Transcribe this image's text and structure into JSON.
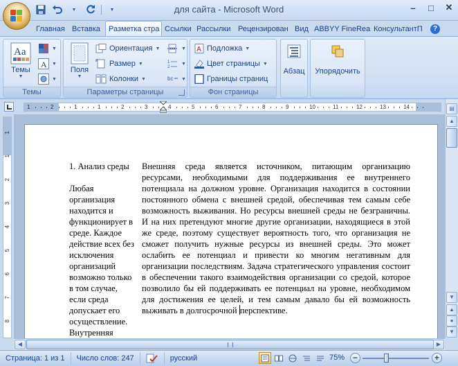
{
  "app": {
    "title": "для сайта - Microsoft Word"
  },
  "window_controls": {
    "minimize": "–",
    "maximize": "□",
    "close": "✕"
  },
  "tabs": [
    {
      "label": "Главная",
      "active": false
    },
    {
      "label": "Вставка",
      "active": false
    },
    {
      "label": "Разметка стра",
      "active": true
    },
    {
      "label": "Ссылки",
      "active": false
    },
    {
      "label": "Рассылки",
      "active": false
    },
    {
      "label": "Рецензирован",
      "active": false
    },
    {
      "label": "Вид",
      "active": false
    },
    {
      "label": "ABBYY FineRea",
      "active": false
    },
    {
      "label": "КонсультантП",
      "active": false
    }
  ],
  "ribbon": {
    "themes_group": {
      "label": "Темы",
      "themes_button": "Темы"
    },
    "page_setup_group": {
      "label": "Параметры страницы",
      "margins_button": "Поля",
      "orientation": "Ориентация",
      "size": "Размер",
      "columns": "Колонки"
    },
    "page_bg_group": {
      "label": "Фон страницы",
      "watermark": "Подложка",
      "page_color": "Цвет страницы",
      "page_borders": "Границы страниц"
    },
    "paragraph_button": "Абзац",
    "arrange_button": "Упорядочить"
  },
  "ruler": {
    "numbers": [
      "1",
      "2",
      "1",
      "1",
      "2",
      "3",
      "4",
      "5",
      "6",
      "7",
      "8",
      "9",
      "10",
      "11",
      "12",
      "13",
      "14"
    ]
  },
  "vruler_numbers": [
    "1",
    "1",
    "2",
    "3",
    "4",
    "5",
    "6",
    "7",
    "8"
  ],
  "document": {
    "left_column": "1. Анализ среды\n\nЛюбая\nорганизация\nнаходится и\nфункционирует в\nсреде. Каждое\nдействие всех без\nисключения\nорганизаций\nвозможно только\nв том случае,\nесли среда\nдопускает его\nосуществление.\nВнутренняя",
    "right_column": "Внешняя  среда является источником, питающим организацию ресурсами, необходимыми для поддерживания ее внутреннего потенциала на должном уровне. Организация находится в состоянии постоянного обмена с внешней средой, обеспечивая тем самым себе возможность выживания. Но ресурсы внешней среды не безграничны. И на них претендуют многие другие организации, находящиеся в этой же среде, поэтому существует вероятность того, что организация не сможет получить нужные ресурсы из внешней среды. Это может ослабить ее потенциал и привести ко многим негативным для организации последствиям. Задача стратегического управления состоит в обеспечении такого взаимодействия организации со средой, которое позволило бы ей поддерживать ее потенциал на уровне, необходимом для достижения ее целей, и тем самым давало бы ей возможность выживать в долгосрочной",
    "right_column_tail": "перспективе."
  },
  "statusbar": {
    "page": "Страница: 1 из 1",
    "words": "Число слов: 247",
    "language": "русский",
    "zoom": "75%",
    "zoom_percent": 75
  }
}
